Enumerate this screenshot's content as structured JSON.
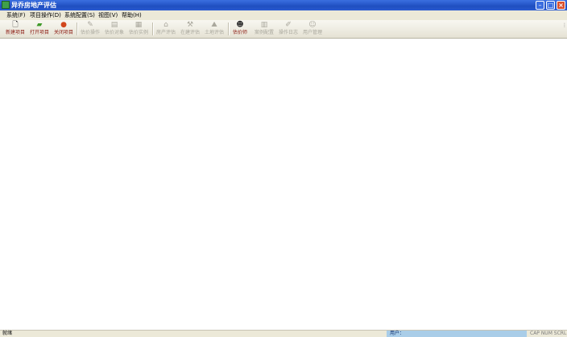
{
  "window": {
    "title": "异乔房地产评估"
  },
  "menu": [
    "系统(F)",
    "项目操作(D)",
    "系统配置(S)",
    "视图(V)",
    "帮助(H)"
  ],
  "toolbar": {
    "new_project": "新建项目",
    "open_project": "打开项目",
    "close_project": "关闭项目",
    "appraisal_ops": "估价操作",
    "appraisal_object": "估价对象",
    "appraisal_example": "估价实例",
    "house_eval": "房产评估",
    "inprogress_eval": "在建评估",
    "land_eval": "土地评估",
    "appraiser": "估价师",
    "case_config": "案例配置",
    "ops_log": "操作日志",
    "user_mgmt": "用户管理"
  },
  "status": {
    "ready": "就绪",
    "user_label": "用户：",
    "keys": "CAP NUM SCRL"
  }
}
